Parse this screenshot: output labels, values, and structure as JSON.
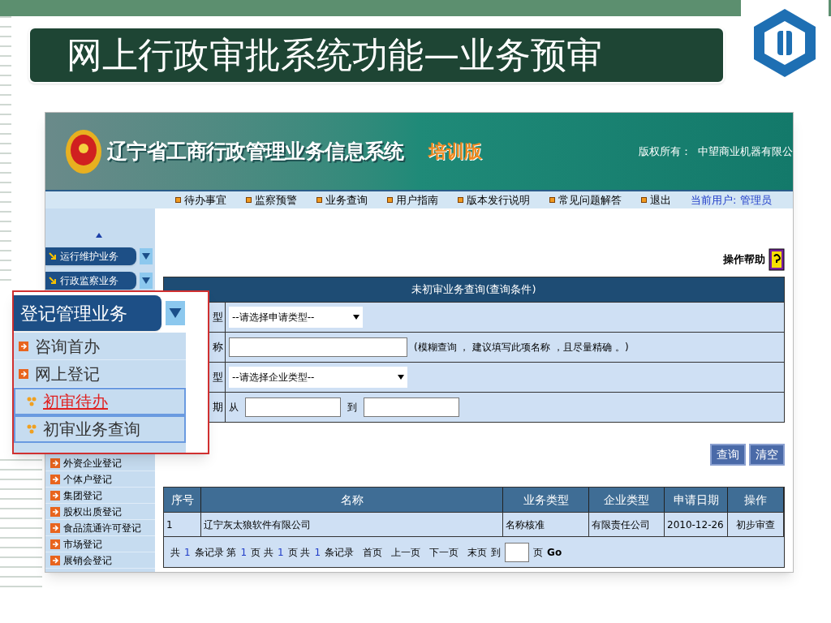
{
  "slide": {
    "title": "网上行政审批系统功能—业务预审"
  },
  "header": {
    "title": "辽宁省工商行政管理业务信息系统",
    "edition": "培训版",
    "copyright": "版权所有：  中望商业机器有限公"
  },
  "nav": {
    "items": [
      "待办事宜",
      "监察预警",
      "业务查询",
      "用户指南",
      "版本发行说明",
      "常见问题解答",
      "退出"
    ],
    "current_user_label": "当前用户:",
    "current_user": "管理员"
  },
  "sidebar": {
    "groups": [
      "运行维护业务",
      "行政监察业务"
    ],
    "items": [
      "外资企业登记",
      "个体户登记",
      "集团登记",
      "股权出质登记",
      "食品流通许可登记",
      "市场登记",
      "展销会登记"
    ]
  },
  "help": "操作帮助",
  "query": {
    "title": "未初审业务查询(查询条件)",
    "rows": [
      {
        "kind": "select",
        "label": "型",
        "value": "--请选择申请类型--"
      },
      {
        "kind": "text",
        "label": "称",
        "note": "(模糊查询 ， 建议填写此项名称 ，且尽量精确 。)"
      },
      {
        "kind": "select",
        "label": "型",
        "value": "--请选择企业类型--"
      },
      {
        "kind": "range",
        "label": "期",
        "from": "从",
        "to": "到"
      }
    ]
  },
  "buttons": [
    "查询",
    "清空"
  ],
  "results": {
    "columns": [
      "序号",
      "名称",
      "业务类型",
      "企业类型",
      "申请日期",
      "操作"
    ],
    "rows": [
      [
        "1",
        "辽宁灰太狼软件有限公司",
        "名称核准",
        "有限责任公司",
        "2010-12-26",
        "初步审查"
      ]
    ],
    "pager": [
      {
        "kind": "text",
        "text": "共"
      },
      {
        "kind": "count",
        "text": "1"
      },
      {
        "kind": "text",
        "text": "条记录 第"
      },
      {
        "kind": "count",
        "text": "1"
      },
      {
        "kind": "text",
        "text": "页 共"
      },
      {
        "kind": "count",
        "text": "1"
      },
      {
        "kind": "text",
        "text": "页 共"
      },
      {
        "kind": "count",
        "text": "1"
      },
      {
        "kind": "text",
        "text": "条记录"
      },
      {
        "kind": "link",
        "text": "首页"
      },
      {
        "kind": "link",
        "text": "上一页"
      },
      {
        "kind": "link",
        "text": "下一页"
      },
      {
        "kind": "link",
        "text": "末页"
      },
      {
        "kind": "text",
        "text": "到"
      },
      {
        "kind": "input"
      },
      {
        "kind": "text",
        "text": "页"
      },
      {
        "kind": "go",
        "text": "Go"
      }
    ]
  },
  "callout": {
    "group": "登记管理业务",
    "items": [
      {
        "kind": "section",
        "label": "咨询首办",
        "selected": false
      },
      {
        "kind": "section",
        "label": "网上登记",
        "selected": false
      },
      {
        "kind": "sub",
        "label": "初审待办",
        "selected": true
      },
      {
        "kind": "sub",
        "label": "初审业务查询",
        "selected": false
      }
    ]
  }
}
